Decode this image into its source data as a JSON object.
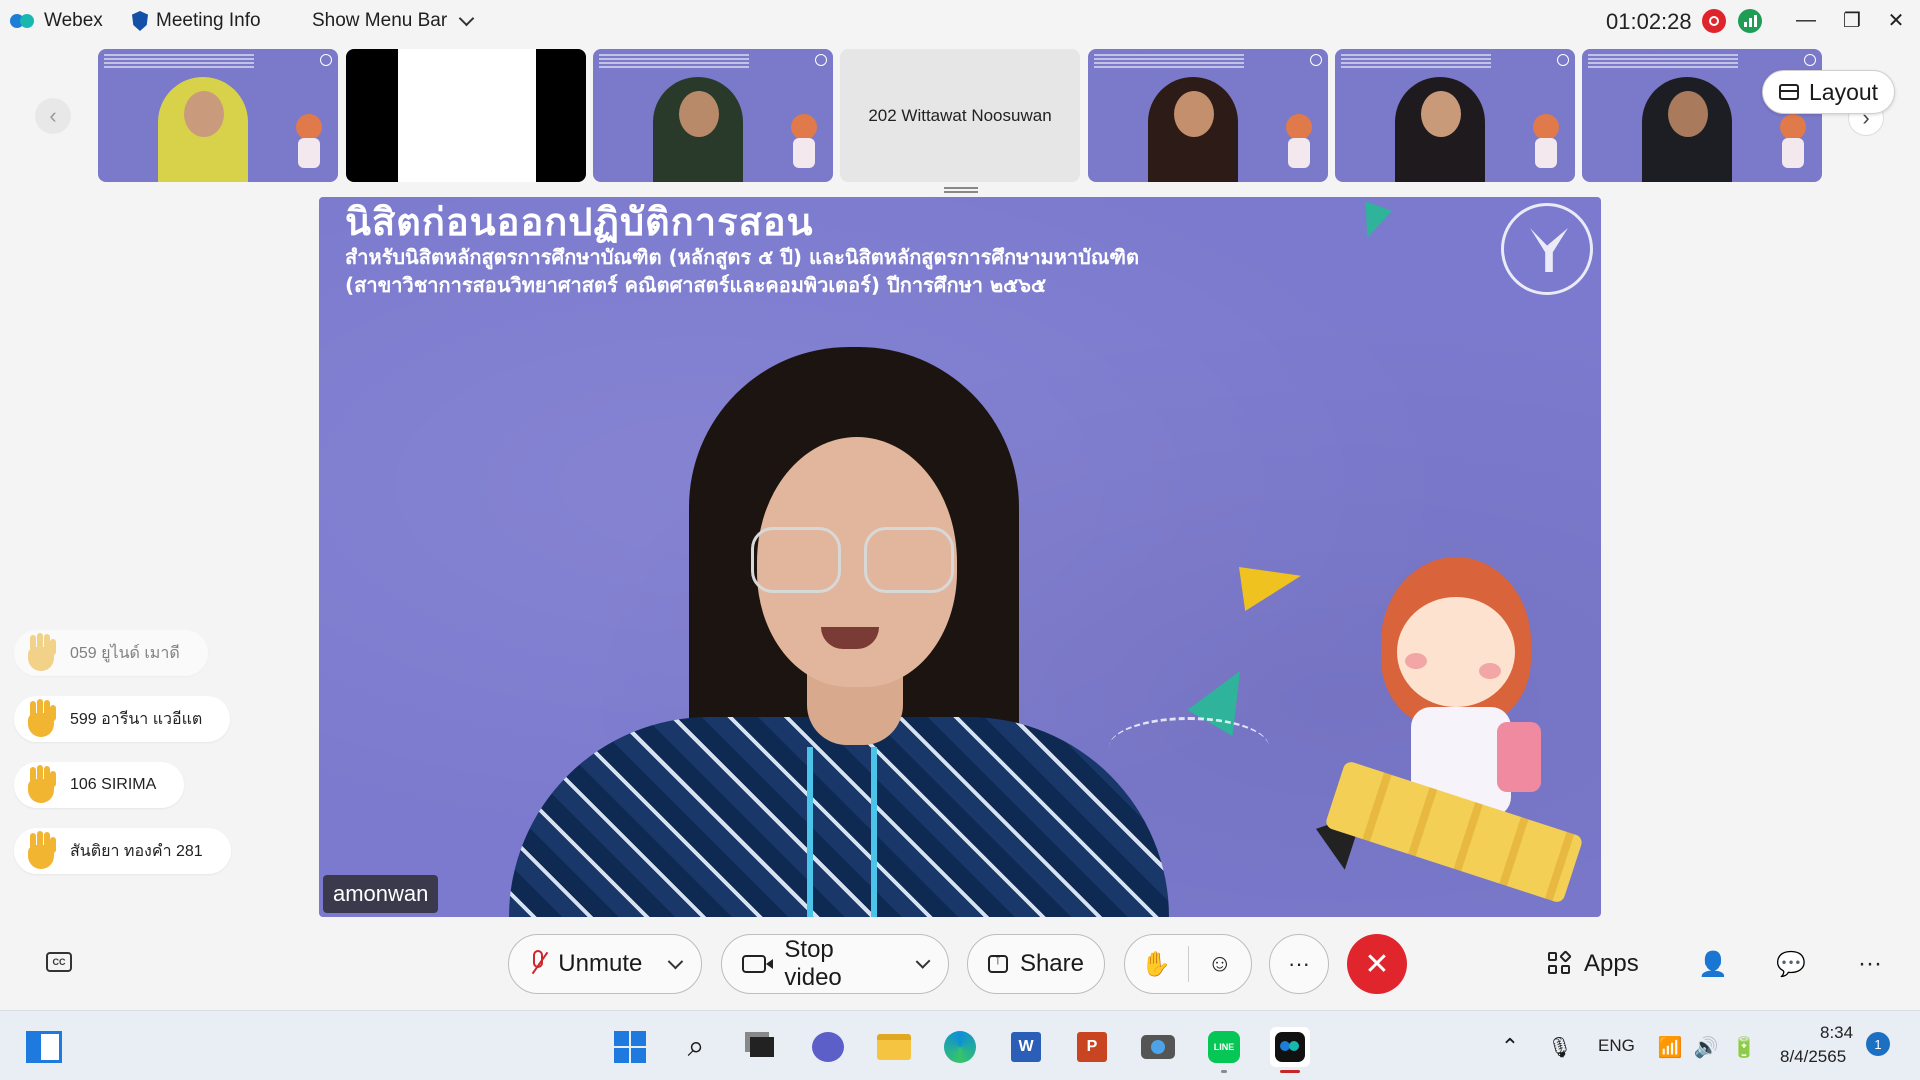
{
  "titlebar": {
    "app_name": "Webex",
    "meeting_info": "Meeting Info",
    "show_menu_bar": "Show Menu Bar",
    "timer": "01:02:28",
    "minimize": "—",
    "restore": "❐",
    "close": "✕"
  },
  "filmstrip": {
    "prev_icon": "‹",
    "next_icon": "›",
    "tiles": [
      {
        "type": "video",
        "skin": "#c99b7c",
        "shirt": "#d8d24a"
      },
      {
        "type": "blank"
      },
      {
        "type": "video",
        "skin": "#b98a6a",
        "shirt": "#2a3a2a"
      },
      {
        "type": "name",
        "label": "202 Wittawat Noosuwan"
      },
      {
        "type": "video",
        "skin": "#c48f6c",
        "shirt": "#2c1b16"
      },
      {
        "type": "video",
        "skin": "#c99a7a",
        "shirt": "#1f1a1e"
      },
      {
        "type": "video",
        "skin": "#a97a5c",
        "shirt": "#1d1d24"
      }
    ],
    "layout_label": "Layout"
  },
  "main_video": {
    "slide_title": "นิสิตก่อนออกปฏิบัติการสอน",
    "slide_sub1": "สำหรับนิสิตหลักสูตรการศึกษาบัณฑิต (หลักสูตร ๕ ปี) และนิสิตหลักสูตรการศึกษามหาบัณฑิต",
    "slide_sub2": "(สาขาวิชาการสอนวิทยาศาสตร์ คณิตศาสตร์และคอมพิวเตอร์) ปีการศึกษา ๒๕๖๕",
    "speaker_name": "amonwan",
    "background_color": "#7c7ace"
  },
  "reactions": [
    {
      "name": "059 ยูไนด์ เมาดี",
      "faded": true
    },
    {
      "name": "599 อารีนา แวอีแต",
      "faded": false
    },
    {
      "name": "106 SIRIMA",
      "faded": false
    },
    {
      "name": "สันติยา ทองคำ 281",
      "faded": false
    }
  ],
  "controls": {
    "unmute": "Unmute",
    "stop_video": "Stop video",
    "share": "Share",
    "raise_hand_icon": "✋",
    "reactions_icon": "☺",
    "more": "···",
    "end": "✕",
    "apps": "Apps",
    "participants_icon": "👤",
    "chat_icon": "💬",
    "overflow": "···",
    "cc": "CC"
  },
  "taskbar": {
    "language": "ENG",
    "time": "8:34",
    "date": "8/4/2565",
    "notifications": "1",
    "chevron_up": "⌃"
  },
  "colors": {
    "accent_red": "#e0252d",
    "webex_blue": "#1c7ed6",
    "slide_purple": "#7c7ace"
  }
}
